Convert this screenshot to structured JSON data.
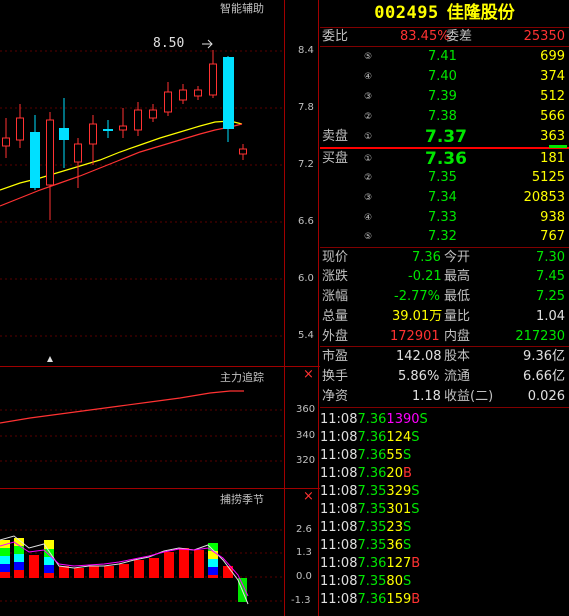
{
  "chart": {
    "main_label": "智能辅助",
    "max_marker": "8.50",
    "main_axis": [
      "8.4",
      "7.8",
      "7.2",
      "6.6",
      "6.0",
      "5.4"
    ],
    "sub1_label": "主力追踪",
    "sub1_axis": [
      "360",
      "340",
      "320"
    ],
    "sub2_label": "捕捞季节",
    "sub2_axis": [
      "2.6",
      "1.3",
      "0.0",
      "-1.3"
    ],
    "close_x": "×"
  },
  "header": {
    "code": "002495",
    "name": "佳隆股份"
  },
  "ratio": {
    "label": "委比",
    "value": "83.45%",
    "diff_label": "委差",
    "diff_value": "25350"
  },
  "asks": [
    {
      "idx": "⑤",
      "price": "7.41",
      "vol": "699"
    },
    {
      "idx": "④",
      "price": "7.40",
      "vol": "374"
    },
    {
      "idx": "③",
      "price": "7.39",
      "vol": "512"
    },
    {
      "idx": "②",
      "price": "7.38",
      "vol": "566"
    },
    {
      "idx": "①",
      "price": "7.37",
      "vol": "363"
    }
  ],
  "bids": [
    {
      "idx": "①",
      "price": "7.36",
      "vol": "181"
    },
    {
      "idx": "②",
      "price": "7.35",
      "vol": "5125"
    },
    {
      "idx": "③",
      "price": "7.34",
      "vol": "20853"
    },
    {
      "idx": "④",
      "price": "7.33",
      "vol": "938"
    },
    {
      "idx": "⑤",
      "price": "7.32",
      "vol": "767"
    }
  ],
  "sell_label": "卖盘",
  "buy_label": "买盘",
  "quote": {
    "now_label": "现价",
    "now": "7.36",
    "open_label": "今开",
    "open": "7.30",
    "chg_label": "涨跌",
    "chg": "-0.21",
    "high_label": "最高",
    "high": "7.45",
    "pct_label": "涨幅",
    "pct": "-2.77%",
    "low_label": "最低",
    "low": "7.25",
    "vol_label": "总量",
    "vol": "39.01万",
    "vr_label": "量比",
    "vr": "1.04",
    "out_label": "外盘",
    "out": "172901",
    "in_label": "内盘",
    "in": "217230"
  },
  "fund": {
    "pe_label": "市盈",
    "pe": "142.08",
    "shares_label": "股本",
    "shares": "9.36亿",
    "turn_label": "换手",
    "turn": "5.86%",
    "float_label": "流通",
    "float": "6.66亿",
    "nav_label": "净资",
    "nav": "1.18",
    "eps_label": "收益(二)",
    "eps": "0.026"
  },
  "ticks": [
    {
      "time": "11:08",
      "price": "7.36",
      "vol": "1390",
      "side": "S"
    },
    {
      "time": "11:08",
      "price": "7.36",
      "vol": "124",
      "side": "S"
    },
    {
      "time": "11:08",
      "price": "7.36",
      "vol": "55",
      "side": "S"
    },
    {
      "time": "11:08",
      "price": "7.36",
      "vol": "20",
      "side": "B"
    },
    {
      "time": "11:08",
      "price": "7.35",
      "vol": "329",
      "side": "S"
    },
    {
      "time": "11:08",
      "price": "7.35",
      "vol": "301",
      "side": "S"
    },
    {
      "time": "11:08",
      "price": "7.35",
      "vol": "23",
      "side": "S"
    },
    {
      "time": "11:08",
      "price": "7.35",
      "vol": "36",
      "side": "S"
    },
    {
      "time": "11:08",
      "price": "7.36",
      "vol": "127",
      "side": "B"
    },
    {
      "time": "11:08",
      "price": "7.35",
      "vol": "80",
      "side": "S"
    },
    {
      "time": "11:08",
      "price": "7.36",
      "vol": "159",
      "side": "B"
    }
  ]
}
